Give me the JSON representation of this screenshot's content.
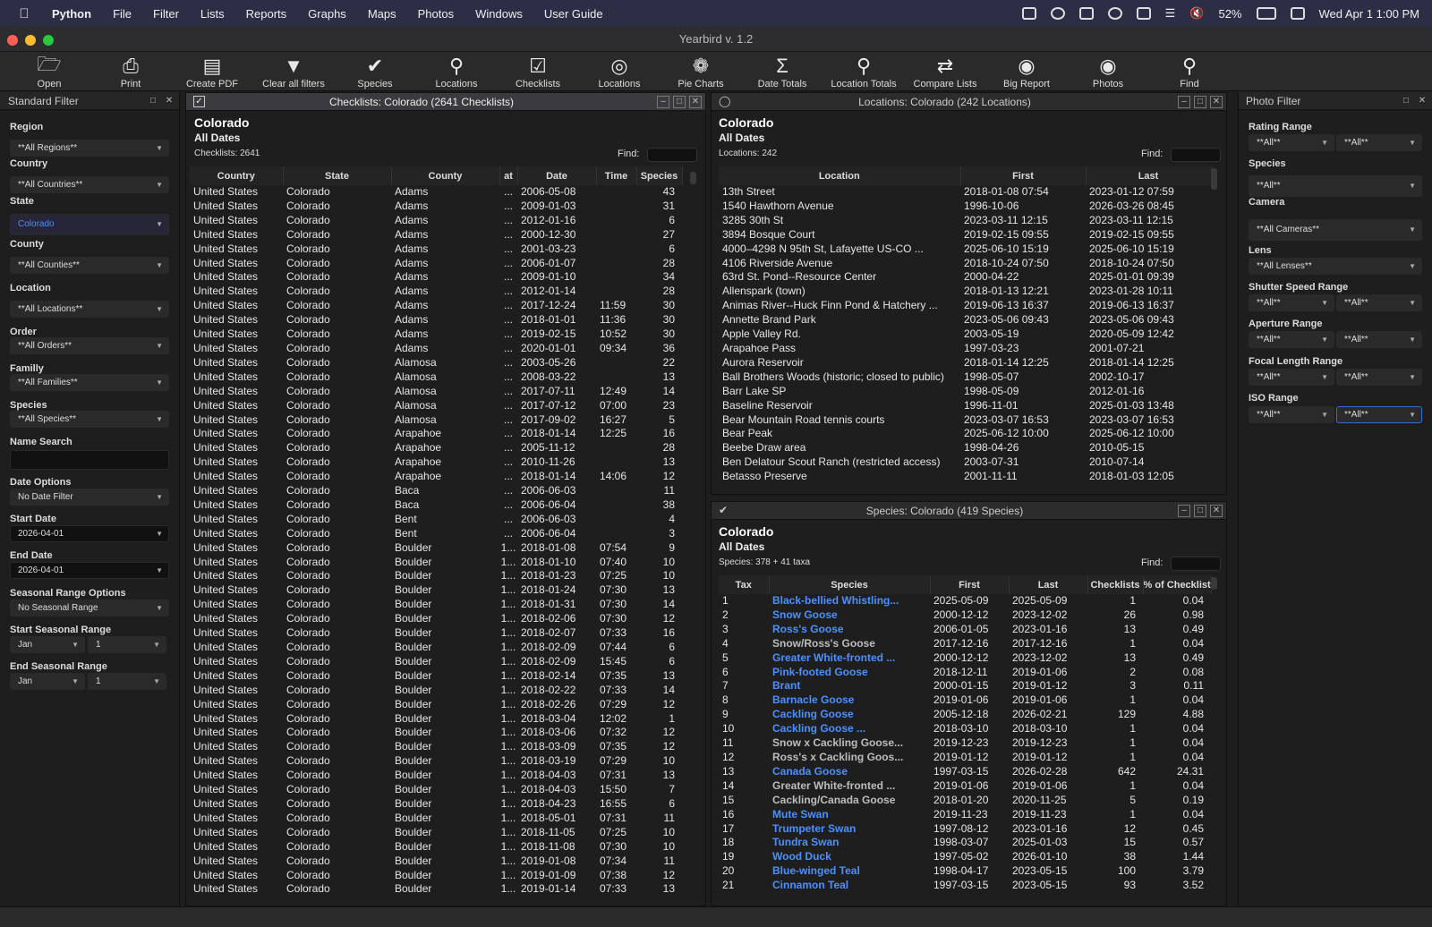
{
  "menubar": {
    "app": "Python",
    "items": [
      "File",
      "Filter",
      "Lists",
      "Reports",
      "Graphs",
      "Maps",
      "Photos",
      "Windows",
      "User Guide"
    ],
    "battery": "52%",
    "datetime": "Wed Apr 1  1:00 PM"
  },
  "window": {
    "title": "Yearbird v. 1.2"
  },
  "toolbar": [
    {
      "label": "Open",
      "icon": "folder-icon"
    },
    {
      "label": "Print",
      "icon": "printer-icon"
    },
    {
      "label": "Create PDF",
      "icon": "pdf-icon"
    },
    {
      "label": "Clear all filters",
      "icon": "funnel-icon"
    },
    {
      "label": "Species",
      "icon": "bird-icon"
    },
    {
      "label": "Locations",
      "icon": "pin-icon"
    },
    {
      "label": "Checklists",
      "icon": "checkbox-icon"
    },
    {
      "label": "Locations",
      "icon": "globe-icon"
    },
    {
      "label": "Pie Charts",
      "icon": "pie-chart-icon"
    },
    {
      "label": "Date Totals",
      "icon": "sigma-icon"
    },
    {
      "label": "Location Totals",
      "icon": "pin-sigma-icon"
    },
    {
      "label": "Compare Lists",
      "icon": "compare-icon"
    },
    {
      "label": "Big Report",
      "icon": "binoculars-icon"
    },
    {
      "label": "Photos",
      "icon": "camera-icon"
    },
    {
      "label": "Find",
      "icon": "magnifier-icon"
    }
  ],
  "standard_filter": {
    "title": "Standard Filter",
    "fields": [
      {
        "label": "Region",
        "value": "**All Regions**"
      },
      {
        "label": "Country",
        "value": "**All Countries**"
      },
      {
        "label": "State",
        "value": "Colorado"
      },
      {
        "label": "County",
        "value": "**All Counties**"
      },
      {
        "label": "Location",
        "value": "**All Locations**"
      },
      {
        "label": "Order",
        "value": "**All Orders**"
      },
      {
        "label": "Familly",
        "value": "**All Families**"
      },
      {
        "label": "Species",
        "value": "**All Species**"
      },
      {
        "label": "Name Search",
        "value": ""
      },
      {
        "label": "Date Options",
        "value": "No Date Filter"
      },
      {
        "label": "Start Date",
        "value": "2026-04-01"
      },
      {
        "label": "End Date",
        "value": "2026-04-01"
      },
      {
        "label": "Seasonal Range Options",
        "value": "No Seasonal Range"
      },
      {
        "label": "Start Seasonal Range",
        "value": "Jan",
        "value2": "1"
      },
      {
        "label": "End Seasonal Range",
        "value": "Jan",
        "value2": "1"
      }
    ]
  },
  "checklists": {
    "header": "Checklists: Colorado (2641 Checklists)",
    "title": "Colorado",
    "subtitle": "All Dates",
    "count": "Checklists: 2641",
    "find": "Find:",
    "columns": [
      "Country",
      "State",
      "County",
      "at",
      "Date",
      "Time",
      "Species"
    ],
    "rows": [
      [
        "United States",
        "Colorado",
        "Adams",
        "...",
        "2006-05-08",
        "",
        "43"
      ],
      [
        "United States",
        "Colorado",
        "Adams",
        "...",
        "2009-01-03",
        "",
        "31"
      ],
      [
        "United States",
        "Colorado",
        "Adams",
        "...",
        "2012-01-16",
        "",
        "6"
      ],
      [
        "United States",
        "Colorado",
        "Adams",
        "...",
        "2000-12-30",
        "",
        "27"
      ],
      [
        "United States",
        "Colorado",
        "Adams",
        "...",
        "2001-03-23",
        "",
        "6"
      ],
      [
        "United States",
        "Colorado",
        "Adams",
        "...",
        "2006-01-07",
        "",
        "28"
      ],
      [
        "United States",
        "Colorado",
        "Adams",
        "...",
        "2009-01-10",
        "",
        "34"
      ],
      [
        "United States",
        "Colorado",
        "Adams",
        "...",
        "2012-01-14",
        "",
        "28"
      ],
      [
        "United States",
        "Colorado",
        "Adams",
        "...",
        "2017-12-24",
        "11:59",
        "30"
      ],
      [
        "United States",
        "Colorado",
        "Adams",
        "...",
        "2018-01-01",
        "11:36",
        "30"
      ],
      [
        "United States",
        "Colorado",
        "Adams",
        "...",
        "2019-02-15",
        "10:52",
        "30"
      ],
      [
        "United States",
        "Colorado",
        "Adams",
        "...",
        "2020-01-01",
        "09:34",
        "36"
      ],
      [
        "United States",
        "Colorado",
        "Alamosa",
        "...",
        "2003-05-26",
        "",
        "22"
      ],
      [
        "United States",
        "Colorado",
        "Alamosa",
        "...",
        "2008-03-22",
        "",
        "13"
      ],
      [
        "United States",
        "Colorado",
        "Alamosa",
        "...",
        "2017-07-11",
        "12:49",
        "14"
      ],
      [
        "United States",
        "Colorado",
        "Alamosa",
        "...",
        "2017-07-12",
        "07:00",
        "23"
      ],
      [
        "United States",
        "Colorado",
        "Alamosa",
        "...",
        "2017-09-02",
        "16:27",
        "5"
      ],
      [
        "United States",
        "Colorado",
        "Arapahoe",
        "...",
        "2018-01-14",
        "12:25",
        "16"
      ],
      [
        "United States",
        "Colorado",
        "Arapahoe",
        "...",
        "2005-11-12",
        "",
        "28"
      ],
      [
        "United States",
        "Colorado",
        "Arapahoe",
        "...",
        "2010-11-26",
        "",
        "13"
      ],
      [
        "United States",
        "Colorado",
        "Arapahoe",
        "...",
        "2018-01-14",
        "14:06",
        "12"
      ],
      [
        "United States",
        "Colorado",
        "Baca",
        "...",
        "2006-06-03",
        "",
        "11"
      ],
      [
        "United States",
        "Colorado",
        "Baca",
        "...",
        "2006-06-04",
        "",
        "38"
      ],
      [
        "United States",
        "Colorado",
        "Bent",
        "...",
        "2006-06-03",
        "",
        "4"
      ],
      [
        "United States",
        "Colorado",
        "Bent",
        "...",
        "2006-06-04",
        "",
        "3"
      ],
      [
        "United States",
        "Colorado",
        "Boulder",
        "1...",
        "2018-01-08",
        "07:54",
        "9"
      ],
      [
        "United States",
        "Colorado",
        "Boulder",
        "1...",
        "2018-01-10",
        "07:40",
        "10"
      ],
      [
        "United States",
        "Colorado",
        "Boulder",
        "1...",
        "2018-01-23",
        "07:25",
        "10"
      ],
      [
        "United States",
        "Colorado",
        "Boulder",
        "1...",
        "2018-01-24",
        "07:30",
        "13"
      ],
      [
        "United States",
        "Colorado",
        "Boulder",
        "1...",
        "2018-01-31",
        "07:30",
        "14"
      ],
      [
        "United States",
        "Colorado",
        "Boulder",
        "1...",
        "2018-02-06",
        "07:30",
        "12"
      ],
      [
        "United States",
        "Colorado",
        "Boulder",
        "1...",
        "2018-02-07",
        "07:33",
        "16"
      ],
      [
        "United States",
        "Colorado",
        "Boulder",
        "1...",
        "2018-02-09",
        "07:44",
        "6"
      ],
      [
        "United States",
        "Colorado",
        "Boulder",
        "1...",
        "2018-02-09",
        "15:45",
        "6"
      ],
      [
        "United States",
        "Colorado",
        "Boulder",
        "1...",
        "2018-02-14",
        "07:35",
        "13"
      ],
      [
        "United States",
        "Colorado",
        "Boulder",
        "1...",
        "2018-02-22",
        "07:33",
        "14"
      ],
      [
        "United States",
        "Colorado",
        "Boulder",
        "1...",
        "2018-02-26",
        "07:29",
        "12"
      ],
      [
        "United States",
        "Colorado",
        "Boulder",
        "1...",
        "2018-03-04",
        "12:02",
        "1"
      ],
      [
        "United States",
        "Colorado",
        "Boulder",
        "1...",
        "2018-03-06",
        "07:32",
        "12"
      ],
      [
        "United States",
        "Colorado",
        "Boulder",
        "1...",
        "2018-03-09",
        "07:35",
        "12"
      ],
      [
        "United States",
        "Colorado",
        "Boulder",
        "1...",
        "2018-03-19",
        "07:29",
        "10"
      ],
      [
        "United States",
        "Colorado",
        "Boulder",
        "1...",
        "2018-04-03",
        "07:31",
        "13"
      ],
      [
        "United States",
        "Colorado",
        "Boulder",
        "1...",
        "2018-04-03",
        "15:50",
        "7"
      ],
      [
        "United States",
        "Colorado",
        "Boulder",
        "1...",
        "2018-04-23",
        "16:55",
        "6"
      ],
      [
        "United States",
        "Colorado",
        "Boulder",
        "1...",
        "2018-05-01",
        "07:31",
        "11"
      ],
      [
        "United States",
        "Colorado",
        "Boulder",
        "1...",
        "2018-11-05",
        "07:25",
        "10"
      ],
      [
        "United States",
        "Colorado",
        "Boulder",
        "1...",
        "2018-11-08",
        "07:30",
        "10"
      ],
      [
        "United States",
        "Colorado",
        "Boulder",
        "1...",
        "2019-01-08",
        "07:34",
        "11"
      ],
      [
        "United States",
        "Colorado",
        "Boulder",
        "1...",
        "2019-01-09",
        "07:38",
        "12"
      ],
      [
        "United States",
        "Colorado",
        "Boulder",
        "1...",
        "2019-01-14",
        "07:33",
        "13"
      ]
    ]
  },
  "locations": {
    "header": "Locations: Colorado (242 Locations)",
    "title": "Colorado",
    "subtitle": "All Dates",
    "count": "Locations: 242",
    "find": "Find:",
    "columns": [
      "Location",
      "First",
      "Last"
    ],
    "rows": [
      [
        "13th Street",
        "2018-01-08 07:54",
        "2023-01-12 07:59"
      ],
      [
        "1540 Hawthorn Avenue",
        "1996-10-06",
        "2026-03-26 08:45"
      ],
      [
        "3285 30th St",
        "2023-03-11 12:15",
        "2023-03-11 12:15"
      ],
      [
        "3894 Bosque Court",
        "2019-02-15 09:55",
        "2019-02-15 09:55"
      ],
      [
        "4000–4298 N 95th St, Lafayette US-CO ...",
        "2025-06-10 15:19",
        "2025-06-10 15:19"
      ],
      [
        "4106 Riverside Avenue",
        "2018-10-24 07:50",
        "2018-10-24 07:50"
      ],
      [
        "63rd St. Pond--Resource Center",
        "2000-04-22",
        "2025-01-01 09:39"
      ],
      [
        "Allenspark (town)",
        "2018-01-13 12:21",
        "2023-01-28 10:11"
      ],
      [
        "Animas River--Huck Finn Pond & Hatchery ...",
        "2019-06-13 16:37",
        "2019-06-13 16:37"
      ],
      [
        "Annette Brand Park",
        "2023-05-06 09:43",
        "2023-05-06 09:43"
      ],
      [
        "Apple Valley Rd.",
        "2003-05-19",
        "2020-05-09 12:42"
      ],
      [
        "Arapahoe Pass",
        "1997-03-23",
        "2001-07-21"
      ],
      [
        "Aurora Reservoir",
        "2018-01-14 12:25",
        "2018-01-14 12:25"
      ],
      [
        "Ball Brothers Woods (historic; closed to public)",
        "1998-05-07",
        "2002-10-17"
      ],
      [
        "Barr Lake SP",
        "1998-05-09",
        "2012-01-16"
      ],
      [
        "Baseline Reservoir",
        "1996-11-01",
        "2025-01-03 13:48"
      ],
      [
        "Bear Mountain Road tennis courts",
        "2023-03-07 16:53",
        "2023-03-07 16:53"
      ],
      [
        "Bear Peak",
        "2025-06-12 10:00",
        "2025-06-12 10:00"
      ],
      [
        "Beebe Draw area",
        "1998-04-26",
        "2010-05-15"
      ],
      [
        "Ben Delatour Scout Ranch (restricted access)",
        "2003-07-31",
        "2010-07-14"
      ],
      [
        "Betasso Preserve",
        "2001-11-11",
        "2018-01-03 12:05"
      ]
    ]
  },
  "species": {
    "header": "Species: Colorado (419 Species)",
    "title": "Colorado",
    "subtitle": "All Dates",
    "count": "Species: 378 + 41 taxa",
    "find": "Find:",
    "columns": [
      "Tax",
      "Species",
      "First",
      "Last",
      "Checklists",
      "% of Checklists"
    ],
    "rows": [
      [
        "1",
        "Black-bellied Whistling...",
        "2025-05-09",
        "2025-05-09",
        "1",
        "0.04",
        true
      ],
      [
        "2",
        "Snow Goose",
        "2000-12-12",
        "2023-12-02",
        "26",
        "0.98",
        true
      ],
      [
        "3",
        "Ross's Goose",
        "2006-01-05",
        "2023-01-16",
        "13",
        "0.49",
        true
      ],
      [
        "4",
        "Snow/Ross's Goose",
        "2017-12-16",
        "2017-12-16",
        "1",
        "0.04",
        false
      ],
      [
        "5",
        "Greater White-fronted ...",
        "2000-12-12",
        "2023-12-02",
        "13",
        "0.49",
        true
      ],
      [
        "6",
        "Pink-footed Goose",
        "2018-12-11",
        "2019-01-06",
        "2",
        "0.08",
        true
      ],
      [
        "7",
        "Brant",
        "2000-01-15",
        "2019-01-12",
        "3",
        "0.11",
        true
      ],
      [
        "8",
        "Barnacle Goose",
        "2019-01-06",
        "2019-01-06",
        "1",
        "0.04",
        true
      ],
      [
        "9",
        "Cackling Goose",
        "2005-12-18",
        "2026-02-21",
        "129",
        "4.88",
        true
      ],
      [
        "10",
        "Cackling Goose ...",
        "2018-03-10",
        "2018-03-10",
        "1",
        "0.04",
        true
      ],
      [
        "11",
        "Snow x Cackling Goose...",
        "2019-12-23",
        "2019-12-23",
        "1",
        "0.04",
        false
      ],
      [
        "12",
        "Ross's x Cackling Goos...",
        "2019-01-12",
        "2019-01-12",
        "1",
        "0.04",
        false
      ],
      [
        "13",
        "Canada Goose",
        "1997-03-15",
        "2026-02-28",
        "642",
        "24.31",
        true
      ],
      [
        "14",
        "Greater White-fronted ...",
        "2019-01-06",
        "2019-01-06",
        "1",
        "0.04",
        false
      ],
      [
        "15",
        "Cackling/Canada Goose",
        "2018-01-20",
        "2020-11-25",
        "5",
        "0.19",
        false
      ],
      [
        "16",
        "Mute Swan",
        "2019-11-23",
        "2019-11-23",
        "1",
        "0.04",
        true
      ],
      [
        "17",
        "Trumpeter Swan",
        "1997-08-12",
        "2023-01-16",
        "12",
        "0.45",
        true
      ],
      [
        "18",
        "Tundra Swan",
        "1998-03-07",
        "2025-01-03",
        "15",
        "0.57",
        true
      ],
      [
        "19",
        "Wood Duck",
        "1997-05-02",
        "2026-01-10",
        "38",
        "1.44",
        true
      ],
      [
        "20",
        "Blue-winged Teal",
        "1998-04-17",
        "2023-05-15",
        "100",
        "3.79",
        true
      ],
      [
        "21",
        "Cinnamon Teal",
        "1997-03-15",
        "2023-05-15",
        "93",
        "3.52",
        true
      ]
    ]
  },
  "photo_filter": {
    "title": "Photo Filter",
    "fields": [
      {
        "label": "Rating Range",
        "value": "**All**",
        "value2": "**All**"
      },
      {
        "label": "Species",
        "value": "**All**"
      },
      {
        "label": "Camera",
        "value": "**All Cameras**"
      },
      {
        "label": "Lens",
        "value": "**All Lenses**"
      },
      {
        "label": "Shutter Speed Range",
        "value": "**All**",
        "value2": "**All**"
      },
      {
        "label": "Aperture Range",
        "value": "**All**",
        "value2": "**All**"
      },
      {
        "label": "Focal Length Range",
        "value": "**All**",
        "value2": "**All**"
      },
      {
        "label": "ISO Range",
        "value": "**All**",
        "value2": "**All**"
      }
    ]
  },
  "colors": {
    "link": "#4c90ff",
    "highlight": "#2f6fd6"
  }
}
